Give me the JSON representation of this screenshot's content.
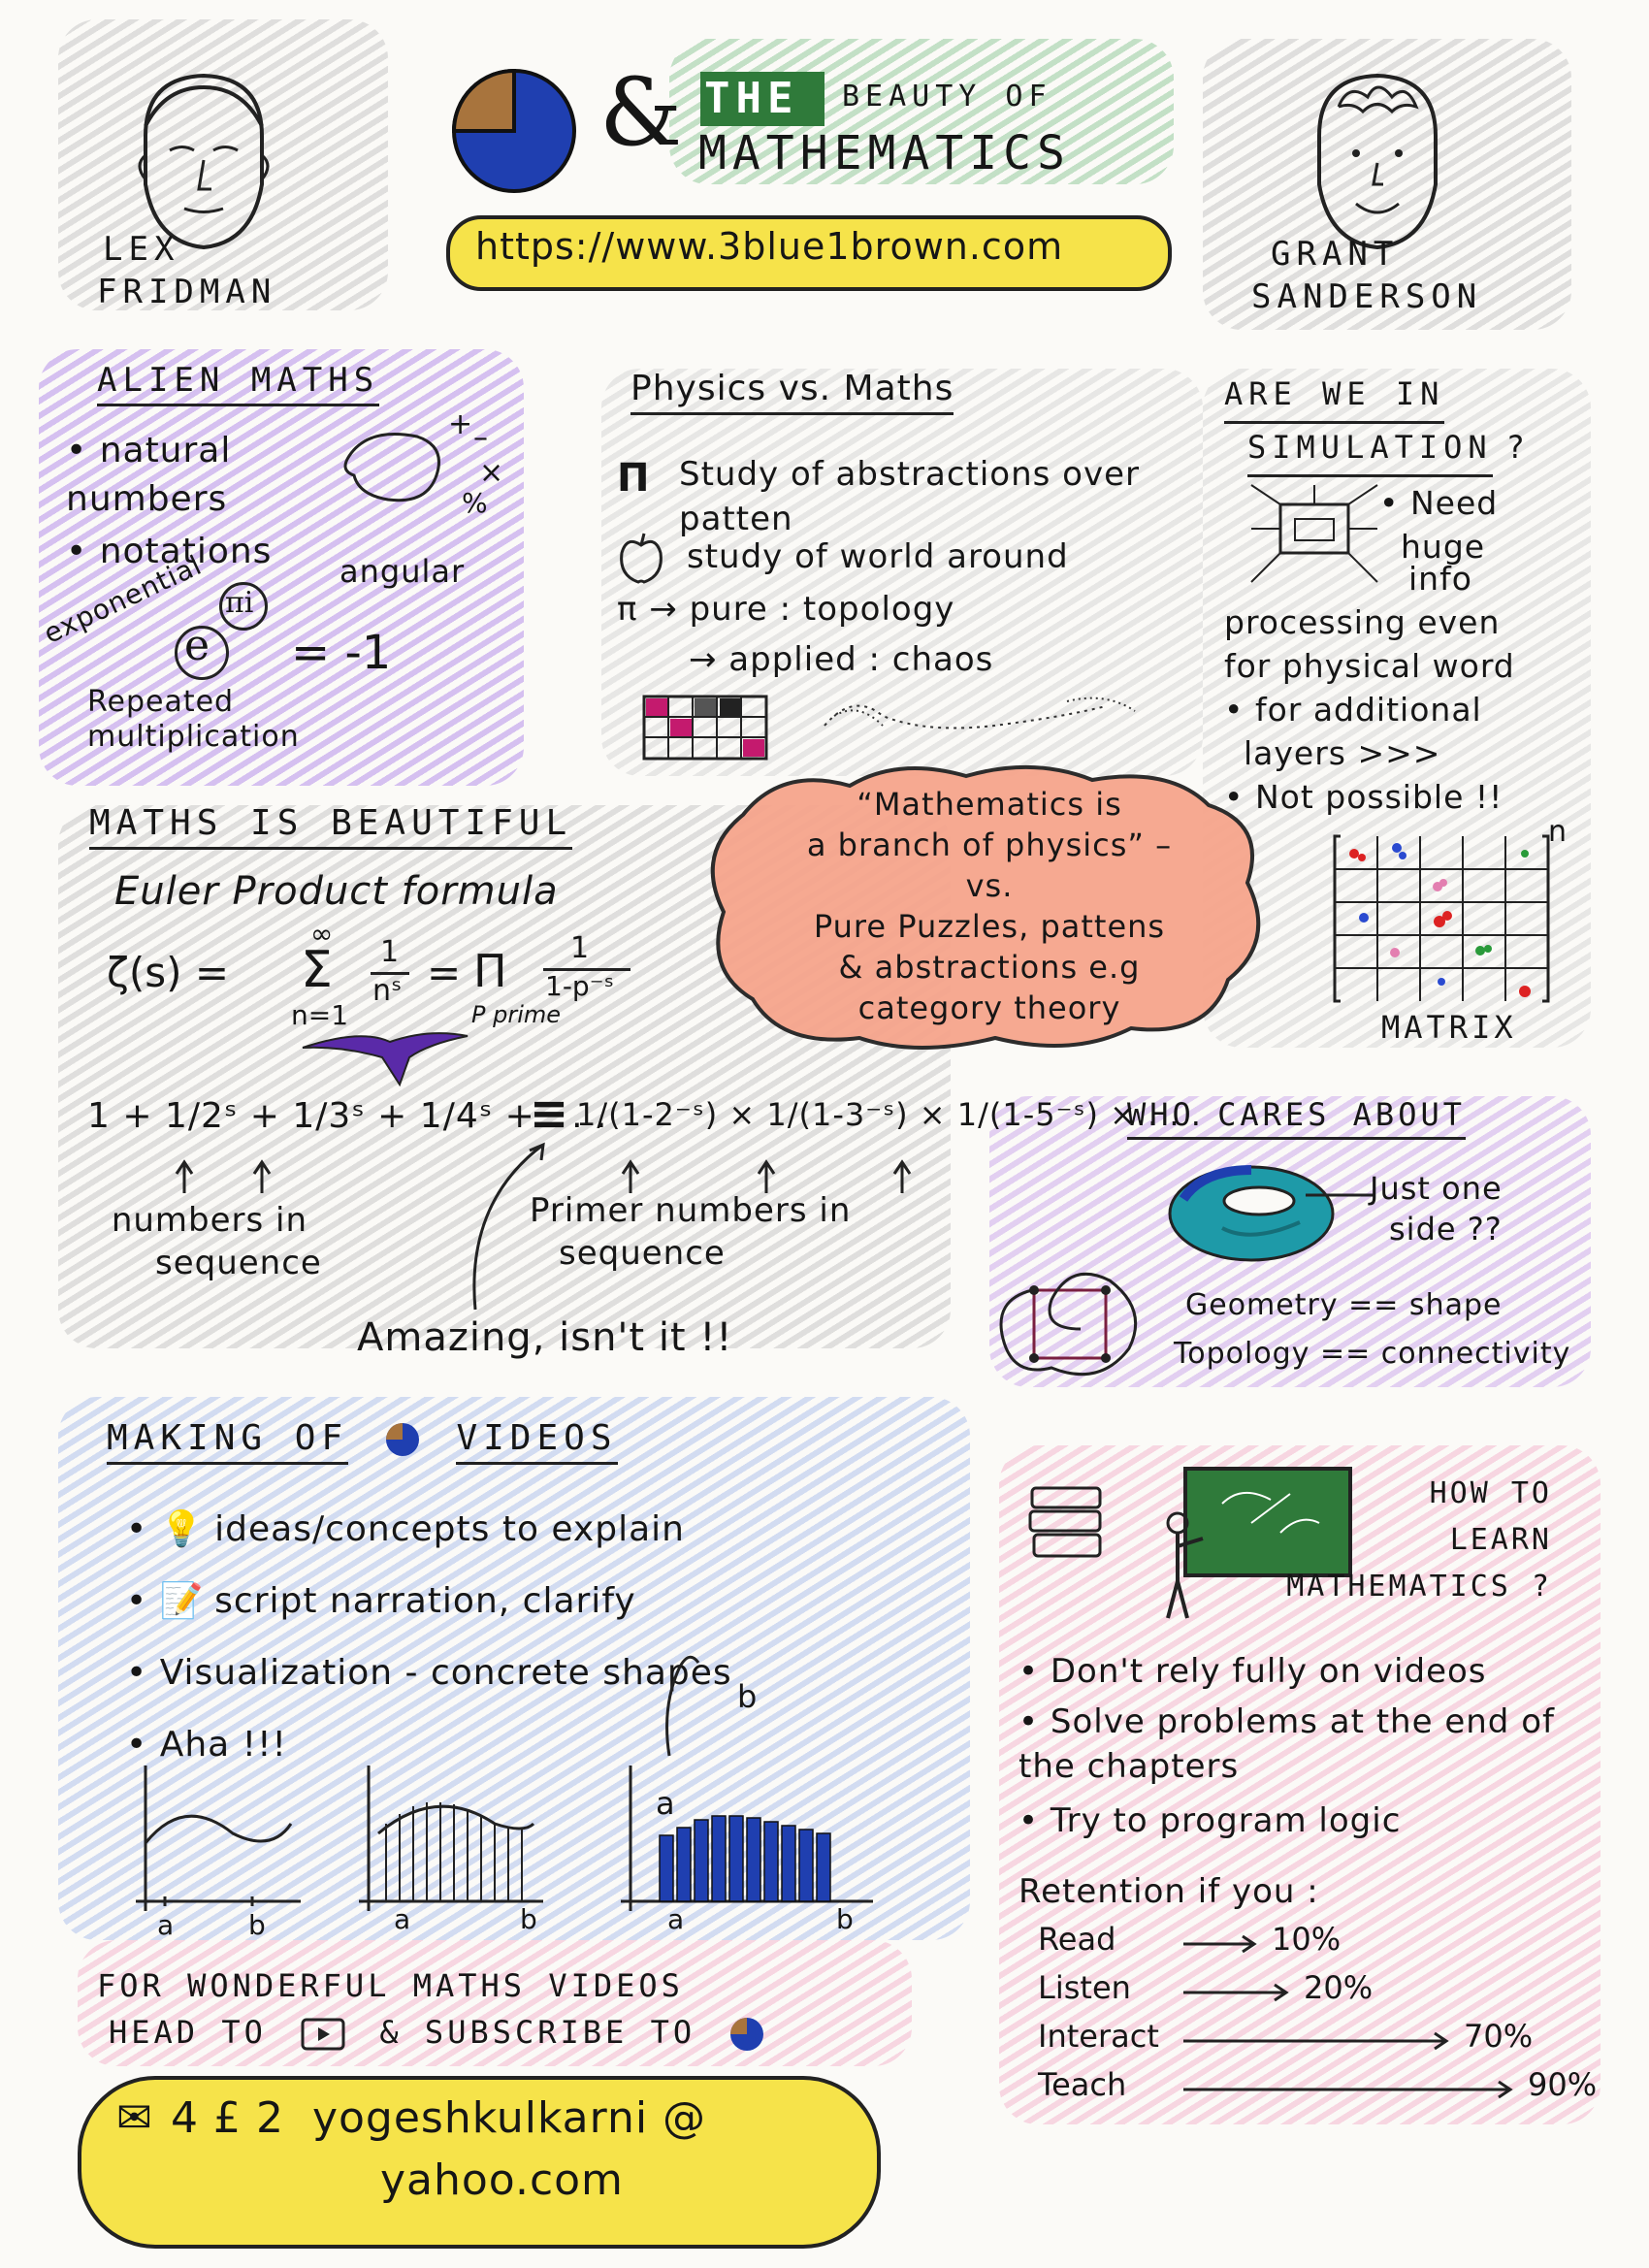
{
  "header": {
    "title_the": "THE",
    "title_rest1": "BEAUTY OF",
    "title_rest2": "MATHEMATICS",
    "ampersand": "&",
    "url": "https://www.3blue1brown.com",
    "person_left": [
      "LEX",
      "FRIDMAN"
    ],
    "person_right": [
      "GRANT",
      "SANDERSON"
    ]
  },
  "alien": {
    "heading": "ALIEN MATHS",
    "items": [
      "natural numbers",
      "notations"
    ],
    "ops": [
      "+",
      "–",
      "×",
      "%"
    ],
    "formula": {
      "e": "e",
      "exp": "πi",
      "rhs": "= -1"
    },
    "labels": [
      "exponential",
      "angular",
      "Repeated",
      "multiplication"
    ]
  },
  "physics": {
    "heading": "Physics vs. Maths",
    "items": [
      "Study of abstractions over patten",
      "study of world around"
    ],
    "lines": [
      "π → pure : topology",
      "→ applied : chaos"
    ]
  },
  "simulation": {
    "heading": [
      "ARE WE IN",
      "SIMULATION",
      "?"
    ],
    "lines": [
      "• Need",
      "huge",
      "info",
      "processing even",
      "for physical word",
      "• for additional",
      "layers >>>",
      "• Not possible !!"
    ],
    "matrix_label": "MATRIX",
    "matrix_n": "n"
  },
  "beautiful": {
    "heading": "MATHS IS BEAUTIFUL",
    "subheading": "Euler Product formula",
    "formula_lhs": "ζ(s) =",
    "sum_top": "∞",
    "sum_sym": "Σ",
    "sum_bottom": "n=1",
    "frac1_top": "1",
    "frac1_bottom": "nˢ",
    "eq": "=",
    "prod_sym": "Π",
    "prod_bottom": "P prime",
    "frac2_top": "1",
    "frac2_bottom": "1-p⁻ˢ",
    "series_left": "1 + 1/2ˢ + 1/3ˢ + 1/4ˢ + . . .",
    "series_eq": "≡",
    "series_right": "1/(1-2⁻ˢ) × 1/(1-3⁻ˢ) × 1/(1-5⁻ˢ) × . . .",
    "note_left": [
      "numbers in",
      "sequence"
    ],
    "note_right": [
      "Primer numbers in",
      "sequence"
    ],
    "amazing": "Amazing, isn't it !!"
  },
  "quote": {
    "lines": [
      "“Mathematics is",
      "a branch of physics” –",
      "vs.",
      "Pure Puzzles, pattens",
      "& abstractions e.g",
      "category theory"
    ]
  },
  "cares": {
    "heading": "WHO CARES ABOUT",
    "note": [
      "Just one",
      "side ??"
    ],
    "geometry": "Geometry == shape",
    "topology": "Topology == connectivity"
  },
  "videos": {
    "heading_a": "MAKING OF",
    "heading_b": "VIDEOS",
    "items": [
      "ideas/concepts to explain",
      "script narration, clarify",
      "Visualization - concrete shapes",
      "Aha !!!"
    ],
    "integral_a": "a",
    "integral_b": "b",
    "axis_labels": [
      "a",
      "b",
      "a",
      "b",
      "a",
      "b"
    ]
  },
  "learn": {
    "heading": [
      "HOW TO",
      "LEARN",
      "MATHEMATICS ?"
    ],
    "items": [
      "Don't rely fully on videos",
      "Solve problems at the end of the chapters",
      "Try to program logic"
    ],
    "retention_title": "Retention if you :",
    "retention": [
      {
        "label": "Read",
        "value": "10%",
        "pct": 10
      },
      {
        "label": "Listen",
        "value": "20%",
        "pct": 20
      },
      {
        "label": "Interact",
        "value": "70%",
        "pct": 70
      },
      {
        "label": "Teach",
        "value": "90%",
        "pct": 90
      }
    ]
  },
  "footer": {
    "line1": "FOR WONDERFUL MATHS VIDEOS",
    "line2a": "HEAD TO",
    "line2b": "& SUBSCRIBE TO",
    "email_prefix": "4 £ 2",
    "email1": "yogeshkulkarni @",
    "email2": "yahoo.com"
  },
  "colors": {
    "purple": "#b08ee6",
    "green": "#9cc79a",
    "blue": "#9fb6ea",
    "pink": "#f2a9c6",
    "yellow": "#f6e34a",
    "salmon": "#f6a58c",
    "navy": "#1f3fb0",
    "brown": "#a8743d",
    "teal": "#1e9aa8",
    "darkgreen": "#2f7a3a"
  }
}
